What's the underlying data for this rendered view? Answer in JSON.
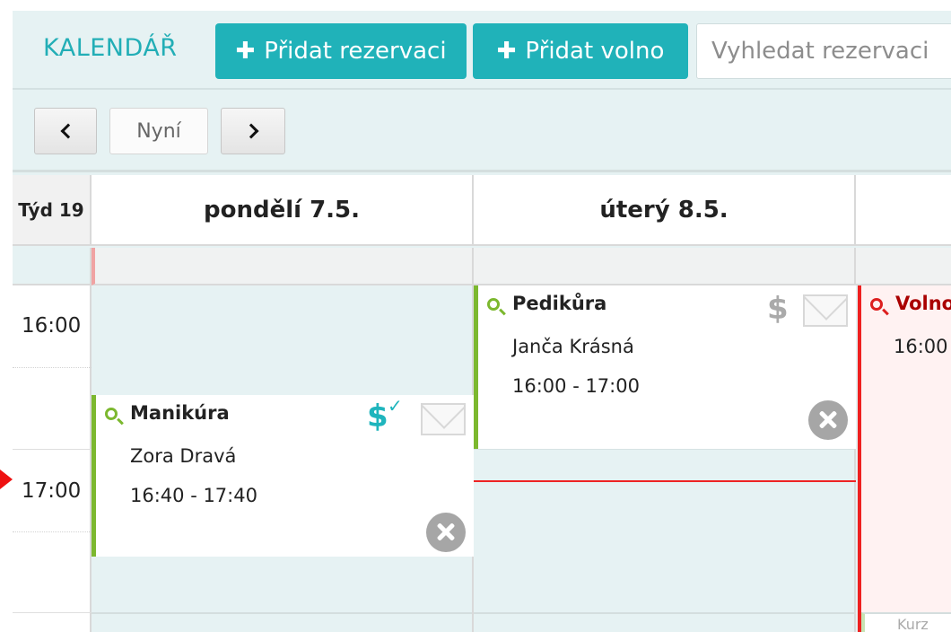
{
  "header": {
    "title": "KALENDÁŘ",
    "add_reservation_label": "Přidat rezervaci",
    "add_free_label": "Přidat volno",
    "search_placeholder": "Vyhledat rezervaci"
  },
  "nav": {
    "now_label": "Nyní"
  },
  "calendar": {
    "week_label": "Týd 19",
    "days": [
      {
        "label": "pondělí 7.5."
      },
      {
        "label": "úterý 8.5."
      }
    ],
    "time_labels": [
      "16:00",
      "17:00"
    ],
    "events": [
      {
        "title": "Manikúra",
        "client": "Zora Dravá",
        "time": "16:40 - 17:40",
        "payment_symbol": "$",
        "paid_check": "✓",
        "status_color": "#7cb82f",
        "payment_color": "#1fb5bd"
      },
      {
        "title": "Pedikůra",
        "client": "Janča Krásná",
        "time": "16:00 - 17:00",
        "payment_symbol": "$",
        "status_color": "#7cb82f",
        "payment_color": "#aaaaaa"
      },
      {
        "title": "Volno",
        "time": "16:00",
        "footer_text": "Kurz",
        "status_color": "#ee2020"
      }
    ]
  },
  "icons": {
    "prev": "chevron-left-icon",
    "next": "chevron-right-icon",
    "plus": "plus-icon",
    "search": "magnifier-icon",
    "mail": "envelope-icon",
    "close": "close-circle-icon",
    "now_marker": "triangle-right-icon"
  },
  "colors": {
    "accent": "#20b2b9",
    "background": "#e6f2f3",
    "now_line": "#ee2424"
  }
}
